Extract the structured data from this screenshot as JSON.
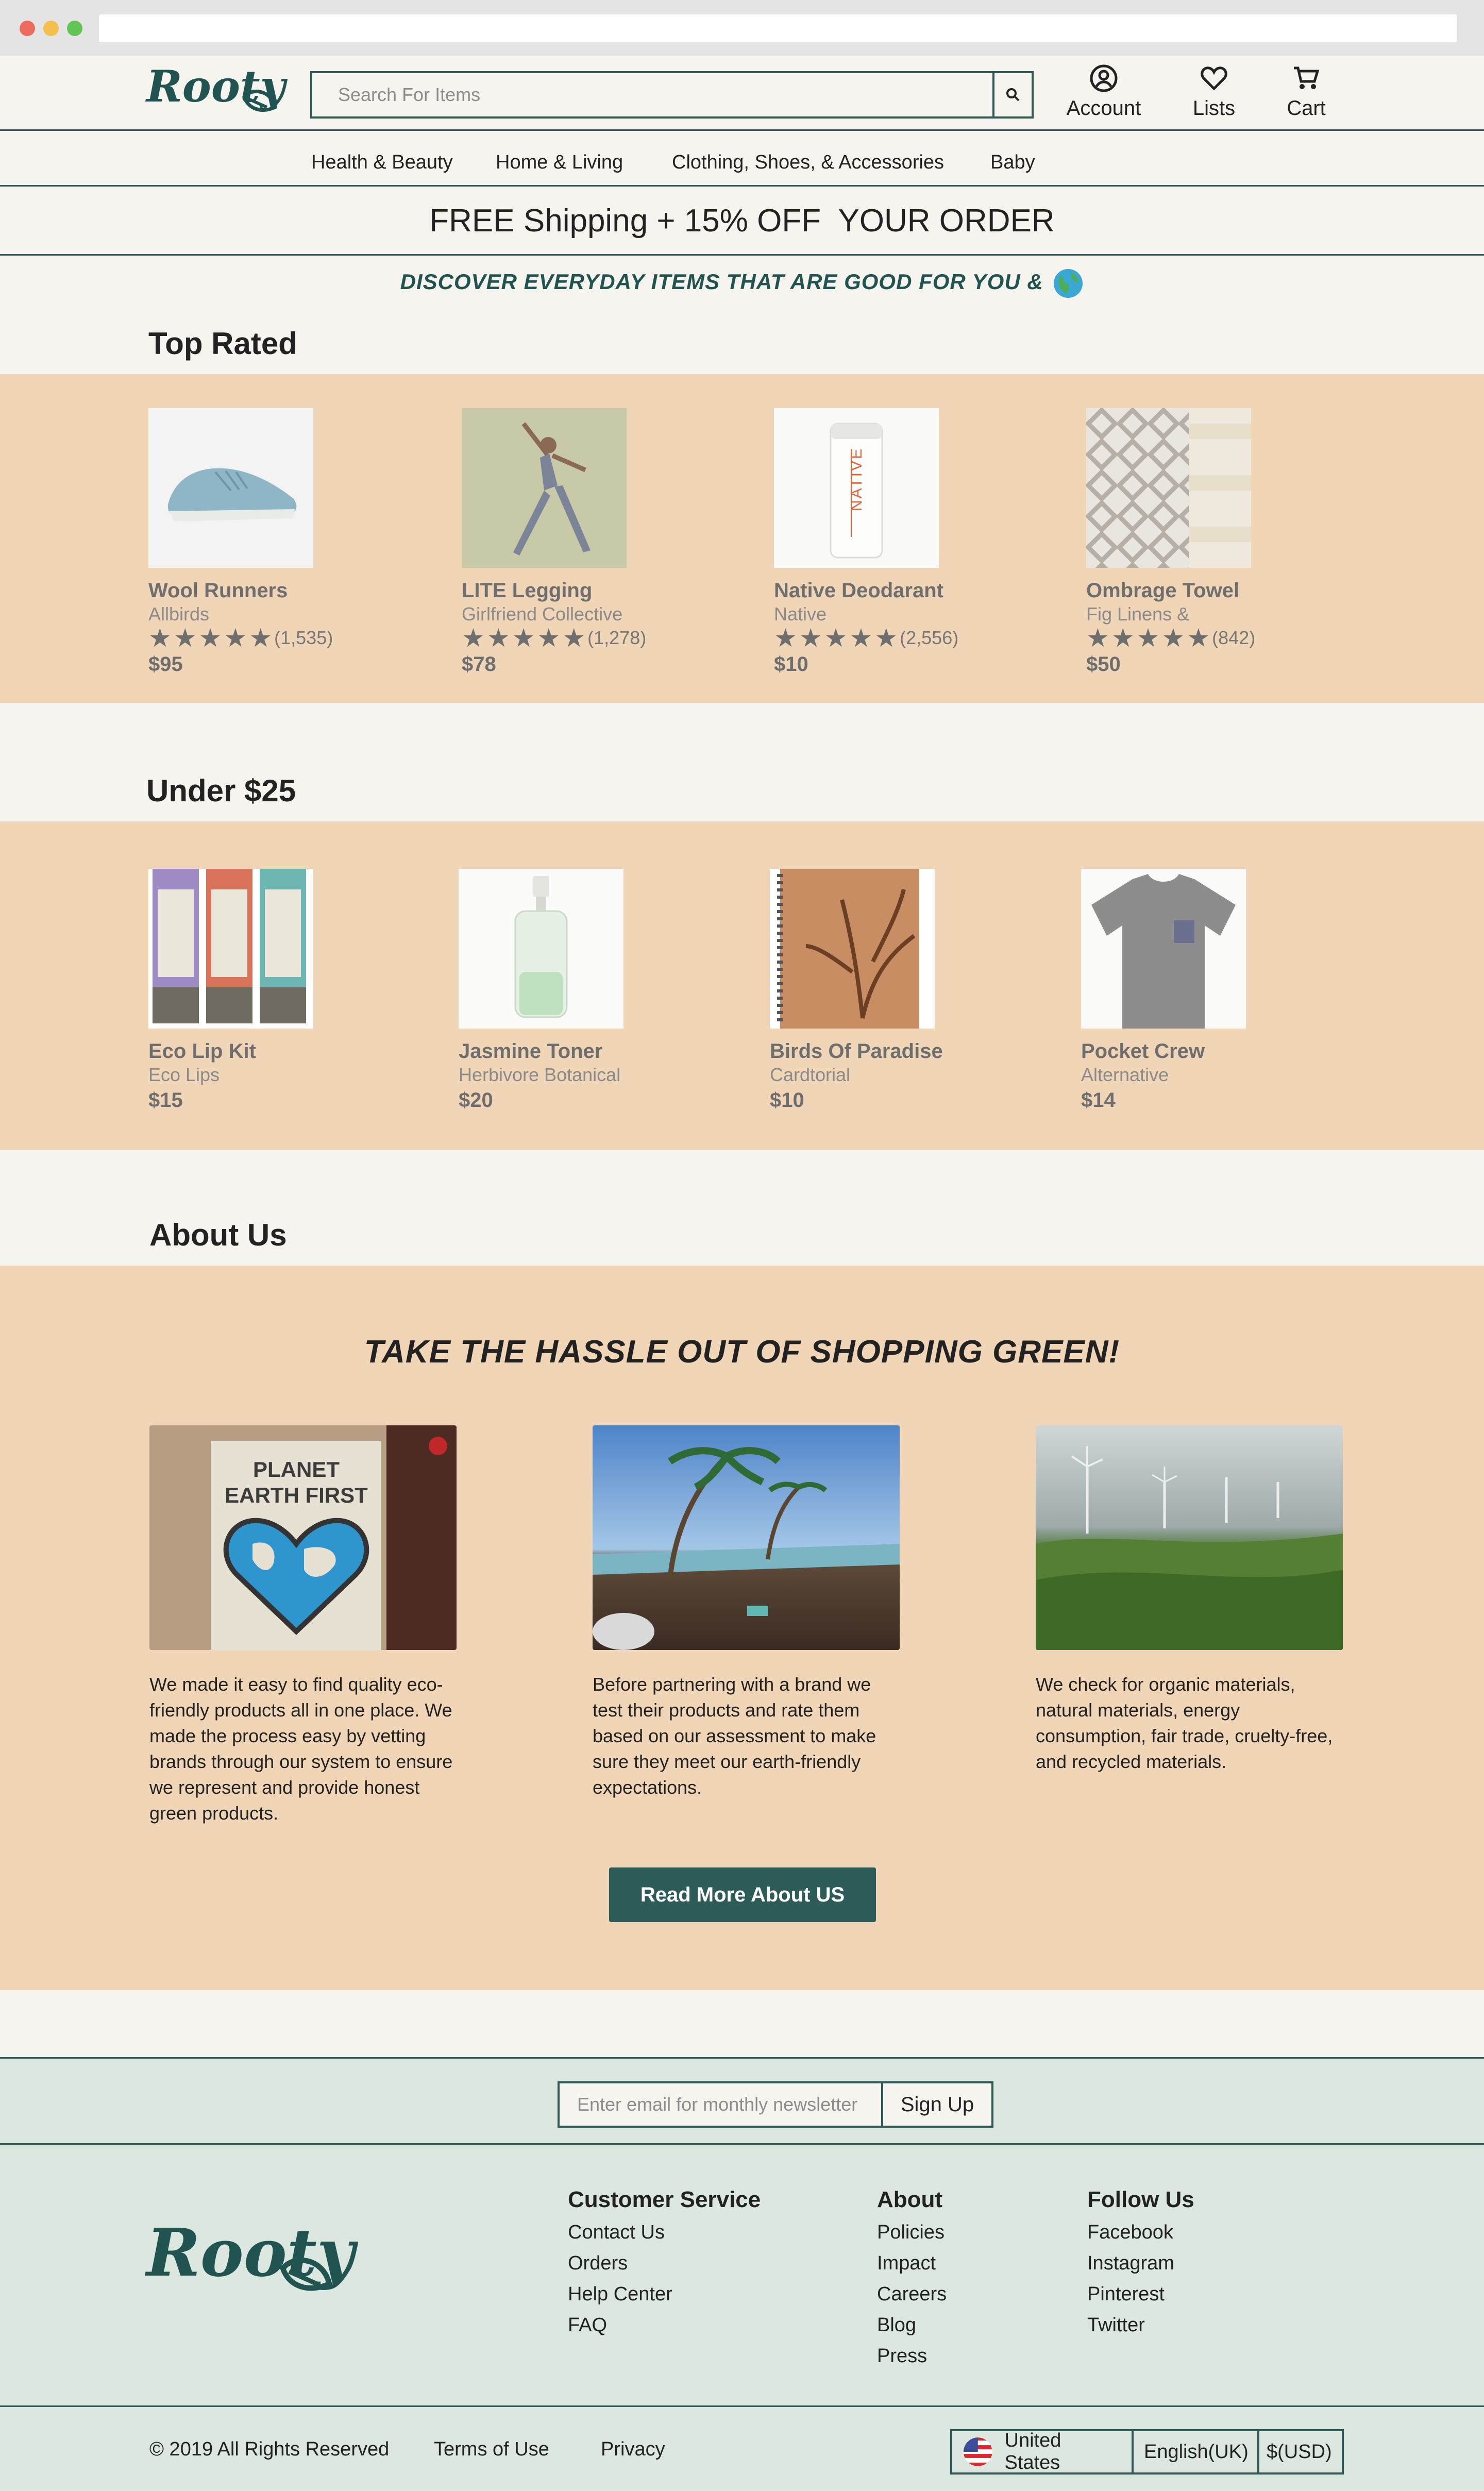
{
  "colors": {
    "accent": "#2f5955",
    "band": "#f0d6b6",
    "background": "#f5f4ee",
    "footer": "#dce7e0"
  },
  "logo": {
    "text": "Rooty"
  },
  "search": {
    "placeholder": "Search For Items",
    "icon": "search-icon"
  },
  "header_actions": [
    {
      "label": "Account",
      "icon": "user-circle-icon"
    },
    {
      "label": "Lists",
      "icon": "heart-icon"
    },
    {
      "label": "Cart",
      "icon": "cart-icon"
    }
  ],
  "nav": {
    "items": [
      "Health & Beauty",
      "Home & Living",
      "Clothing, Shoes, & Accessories",
      "Baby"
    ]
  },
  "promo": {
    "text": "FREE Shipping + 15% OFF  YOUR ORDER"
  },
  "tagline": {
    "text": "DISCOVER EVERYDAY ITEMS THAT ARE GOOD FOR YOU &",
    "icon": "globe-icon"
  },
  "top_rated": {
    "title": "Top Rated",
    "products": [
      {
        "name": "Wool Runners",
        "brand": "Allbirds",
        "rating": 5,
        "reviews": "(1,535)",
        "price": "$95",
        "image": "shoe-image"
      },
      {
        "name": "LITE Legging",
        "brand": "Girlfriend Collective",
        "rating": 5,
        "reviews": "(1,278)",
        "price": "$78",
        "image": "legging-image"
      },
      {
        "name": "Native Deodarant",
        "brand": "Native",
        "rating": 5,
        "reviews": "(2,556)",
        "price": "$10",
        "image": "deodorant-image"
      },
      {
        "name": "Ombrage Towel",
        "brand": "Fig Linens &",
        "rating": 5,
        "reviews": "(842)",
        "price": "$50",
        "image": "towel-image"
      }
    ]
  },
  "under25": {
    "title": "Under $25",
    "products": [
      {
        "name": "Eco Lip Kit",
        "brand": "Eco Lips",
        "price": "$15",
        "image": "lip-kit-image"
      },
      {
        "name": "Jasmine Toner",
        "brand": "Herbivore Botanical",
        "price": "$20",
        "image": "toner-image"
      },
      {
        "name": "Birds Of Paradise",
        "brand": "Cardtorial",
        "price": "$10",
        "image": "notebook-image"
      },
      {
        "name": "Pocket Crew",
        "brand": "Alternative",
        "price": "$14",
        "image": "tshirt-image"
      }
    ]
  },
  "about": {
    "title": "About Us",
    "headline": "TAKE THE HASSLE OUT OF SHOPPING GREEN!",
    "poster_text_1": "PLANET",
    "poster_text_2": "EARTH FIRST",
    "cards": [
      {
        "text": "We made it easy to find quality eco-friendly products all in one place. We made the process easy by vetting brands through our system to ensure we represent and provide honest green products.",
        "image": "planet-earth-first-poster-image"
      },
      {
        "text": "Before partnering with a brand we test their products and rate them based on our assessment to make sure they meet our earth-friendly expectations.",
        "image": "polluted-beach-image"
      },
      {
        "text": "We check for organic materials, natural materials, energy consumption, fair trade, cruelty-free, and recycled materials.",
        "image": "wind-turbines-image"
      }
    ],
    "button": "Read More About US"
  },
  "newsletter": {
    "placeholder": "Enter email for monthly newsletter",
    "button": "Sign Up"
  },
  "footer": {
    "columns": [
      {
        "heading": "Customer Service",
        "links": [
          "Contact Us",
          "Orders",
          "Help Center",
          "FAQ"
        ]
      },
      {
        "heading": "About",
        "links": [
          "Policies",
          "Impact",
          "Careers",
          "Blog",
          "Press"
        ]
      },
      {
        "heading": "Follow Us",
        "links": [
          "Facebook",
          "Instagram",
          "Pinterest",
          "Twitter"
        ]
      }
    ],
    "copyright": "© 2019 All Rights Reserved",
    "terms": "Terms of Use",
    "privacy": "Privacy",
    "country": "United States",
    "language": "English(UK)",
    "currency": "$(USD)"
  }
}
